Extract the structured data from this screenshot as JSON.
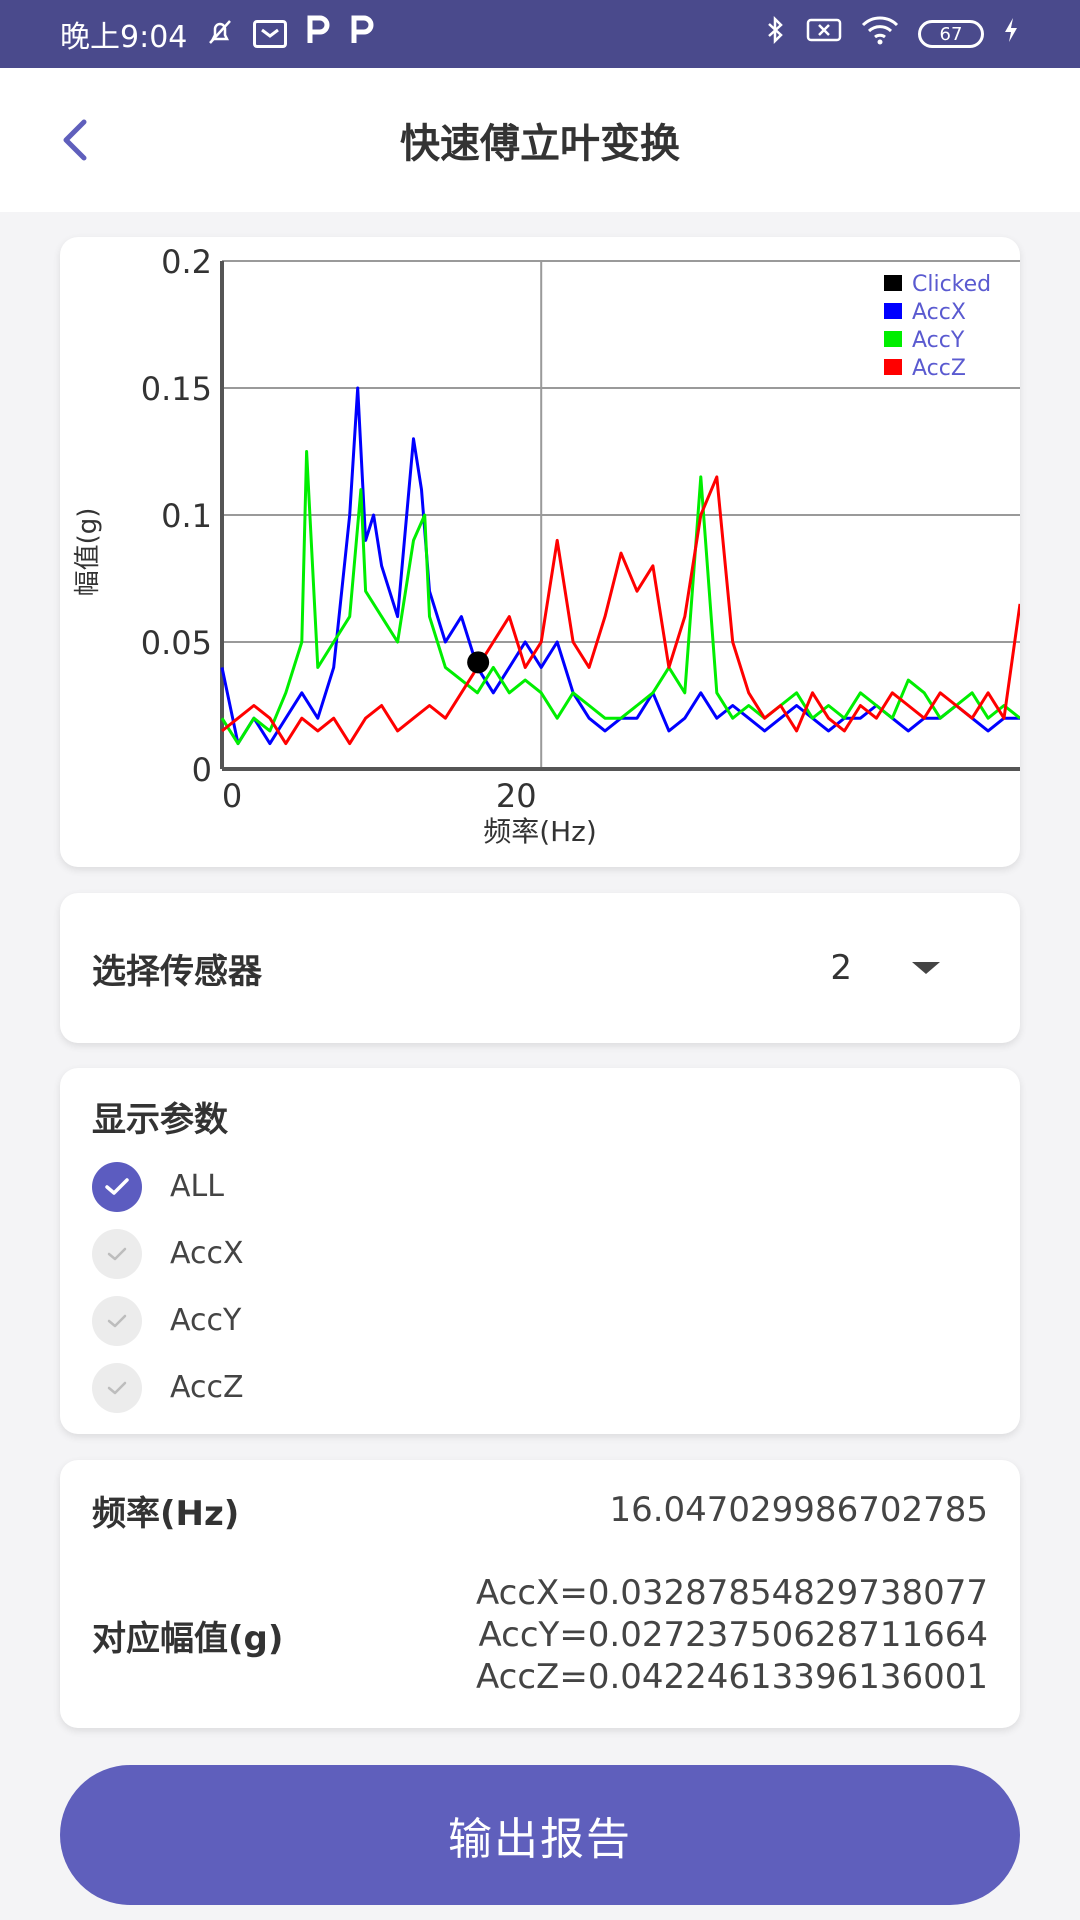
{
  "status_bar": {
    "time": "晚上9:04",
    "battery": "67",
    "icons": [
      "mute-bell-icon",
      "app-notification-icon",
      "p-icon",
      "p-icon",
      "bluetooth-icon",
      "sim-icon",
      "wifi-icon",
      "battery-icon",
      "charging-icon"
    ]
  },
  "header": {
    "title": "快速傅立叶变换",
    "back_icon": "chevron-left-icon"
  },
  "chart_data": {
    "type": "line",
    "xlabel": "频率(Hz)",
    "ylabel": "幅值(g)",
    "x_ticks": [
      "0",
      "20"
    ],
    "y_ticks": [
      "0",
      "0.05",
      "0.1",
      "0.15",
      "0.2"
    ],
    "ylim": [
      0,
      0.2
    ],
    "xlim": [
      0,
      50
    ],
    "grid": true,
    "legend_position": "top-right",
    "legend": [
      "Clicked",
      "AccX",
      "AccY",
      "AccZ"
    ],
    "colors": {
      "Clicked": "#000000",
      "AccX": "#0000ff",
      "AccY": "#00ee00",
      "AccZ": "#ff0000"
    },
    "clicked_point": {
      "x": 16.05,
      "y": 0.042
    },
    "series": [
      {
        "name": "AccX",
        "color": "#0000ff",
        "x": [
          0,
          1,
          2,
          3,
          4,
          5,
          6,
          7,
          8,
          8.5,
          9,
          9.5,
          10,
          11,
          12,
          12.5,
          13,
          14,
          15,
          16,
          17,
          18,
          19,
          20,
          21,
          22,
          23,
          24,
          25,
          26,
          27,
          28,
          29,
          30,
          31,
          32,
          33,
          34,
          35,
          36,
          37,
          38,
          39,
          40,
          41,
          42,
          43,
          44,
          45,
          46,
          47,
          48,
          49,
          50
        ],
        "y": [
          0.04,
          0.01,
          0.02,
          0.01,
          0.02,
          0.03,
          0.02,
          0.04,
          0.1,
          0.15,
          0.09,
          0.1,
          0.08,
          0.06,
          0.13,
          0.11,
          0.07,
          0.05,
          0.06,
          0.04,
          0.03,
          0.04,
          0.05,
          0.04,
          0.05,
          0.03,
          0.02,
          0.015,
          0.02,
          0.02,
          0.03,
          0.015,
          0.02,
          0.03,
          0.02,
          0.025,
          0.02,
          0.015,
          0.02,
          0.025,
          0.02,
          0.015,
          0.02,
          0.02,
          0.025,
          0.02,
          0.015,
          0.02,
          0.02,
          0.025,
          0.02,
          0.015,
          0.02,
          0.02
        ]
      },
      {
        "name": "AccY",
        "color": "#00ee00",
        "x": [
          0,
          1,
          2,
          3,
          4,
          5,
          5.3,
          6,
          7,
          8,
          8.7,
          9,
          10,
          11,
          12,
          12.7,
          13,
          14,
          15,
          16,
          17,
          18,
          19,
          20,
          21,
          22,
          23,
          24,
          25,
          26,
          27,
          28,
          29,
          30,
          31,
          32,
          33,
          34,
          35,
          36,
          37,
          38,
          39,
          40,
          41,
          42,
          43,
          44,
          45,
          46,
          47,
          48,
          49,
          50
        ],
        "y": [
          0.02,
          0.01,
          0.02,
          0.015,
          0.03,
          0.05,
          0.125,
          0.04,
          0.05,
          0.06,
          0.11,
          0.07,
          0.06,
          0.05,
          0.09,
          0.1,
          0.06,
          0.04,
          0.035,
          0.03,
          0.04,
          0.03,
          0.035,
          0.03,
          0.02,
          0.03,
          0.025,
          0.02,
          0.02,
          0.025,
          0.03,
          0.04,
          0.03,
          0.115,
          0.03,
          0.02,
          0.025,
          0.02,
          0.025,
          0.03,
          0.02,
          0.025,
          0.02,
          0.03,
          0.025,
          0.02,
          0.035,
          0.03,
          0.02,
          0.025,
          0.03,
          0.02,
          0.025,
          0.02
        ]
      },
      {
        "name": "AccZ",
        "color": "#ff0000",
        "x": [
          0,
          1,
          2,
          3,
          4,
          5,
          6,
          7,
          8,
          9,
          10,
          11,
          12,
          13,
          14,
          15,
          16,
          17,
          18,
          19,
          20,
          21,
          22,
          23,
          24,
          25,
          26,
          27,
          28,
          29,
          30,
          31,
          32,
          33,
          34,
          35,
          36,
          37,
          38,
          39,
          40,
          41,
          42,
          43,
          44,
          45,
          46,
          47,
          48,
          49,
          50
        ],
        "y": [
          0.015,
          0.02,
          0.025,
          0.02,
          0.01,
          0.02,
          0.015,
          0.02,
          0.01,
          0.02,
          0.025,
          0.015,
          0.02,
          0.025,
          0.02,
          0.03,
          0.04,
          0.05,
          0.06,
          0.04,
          0.05,
          0.09,
          0.05,
          0.04,
          0.06,
          0.085,
          0.07,
          0.08,
          0.04,
          0.06,
          0.1,
          0.115,
          0.05,
          0.03,
          0.02,
          0.025,
          0.015,
          0.03,
          0.02,
          0.015,
          0.025,
          0.02,
          0.03,
          0.025,
          0.02,
          0.03,
          0.025,
          0.02,
          0.03,
          0.02,
          0.065
        ]
      }
    ]
  },
  "sensor": {
    "label": "选择传感器",
    "value": "2"
  },
  "params": {
    "title": "显示参数",
    "options": [
      {
        "label": "ALL",
        "checked": true
      },
      {
        "label": "AccX",
        "checked": false
      },
      {
        "label": "AccY",
        "checked": false
      },
      {
        "label": "AccZ",
        "checked": false
      }
    ]
  },
  "result": {
    "freq_label": "频率(Hz)",
    "freq_value": "16.047029986702785",
    "amp_label": "对应幅值(g)",
    "amp_x": "AccX=0.03287854829738077",
    "amp_y": "AccY=0.02723750628711664",
    "amp_z": "AccZ=0.04224613396136001"
  },
  "export_button": "输出报告",
  "accent_color": "#5f5fbc"
}
